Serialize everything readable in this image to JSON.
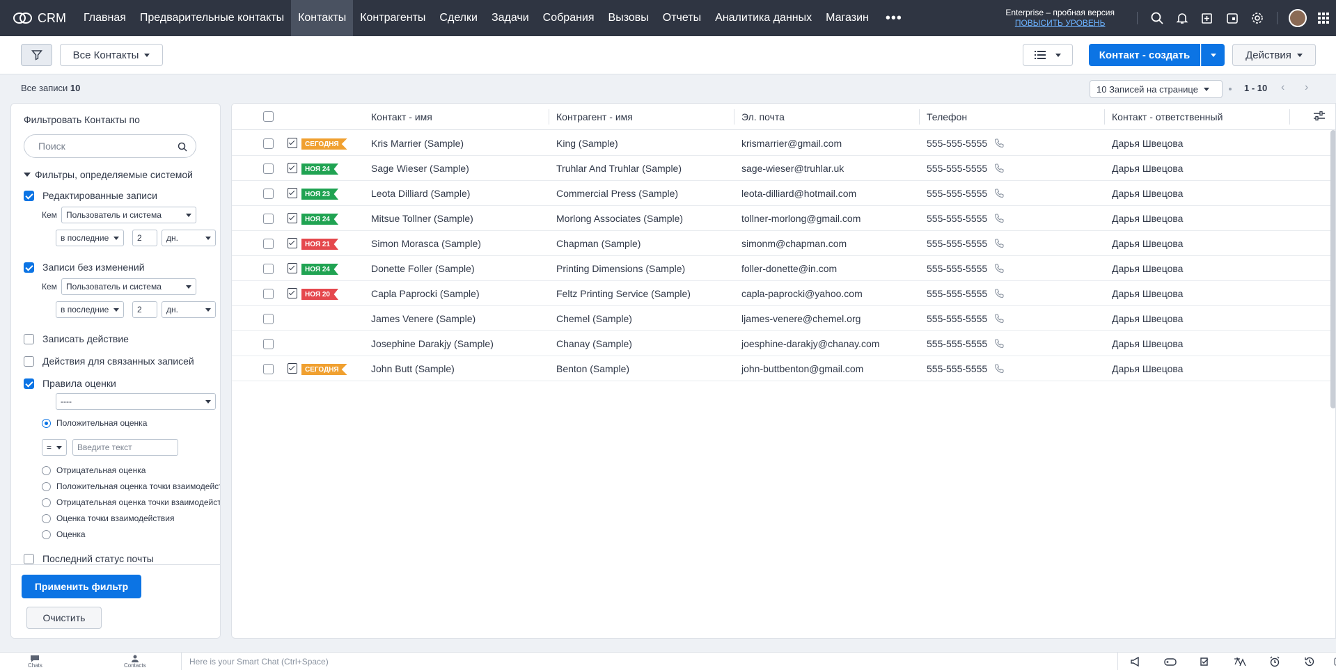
{
  "app": {
    "name": "CRM"
  },
  "nav": {
    "items": [
      "Главная",
      "Предварительные контакты",
      "Контакты",
      "Контрагенты",
      "Сделки",
      "Задачи",
      "Собрания",
      "Вызовы",
      "Отчеты",
      "Аналитика данных",
      "Магазин"
    ],
    "active_index": 2,
    "more": "•••",
    "trial_text": "Enterprise – пробная версия",
    "upgrade_link": "ПОВЫСИТЬ УРОВЕНЬ"
  },
  "toolbar": {
    "view_label": "Все Контакты",
    "create_label": "Контакт - создать",
    "actions_label": "Действия"
  },
  "records": {
    "total_label": "Все записи",
    "total_count": "10",
    "per_page": "10 Записей на странице",
    "range": "1 - 10"
  },
  "filters": {
    "title": "Фильтровать Контакты по",
    "search_placeholder": "Поиск",
    "system_section": "Фильтры, определяемые системой",
    "edited": {
      "label": "Редактированные записи",
      "by_label": "Кем",
      "by_value": "Пользователь и система",
      "period": "в последние",
      "count": "2",
      "unit": "дн."
    },
    "unchanged": {
      "label": "Записи без изменений",
      "by_label": "Кем",
      "by_value": "Пользователь и система",
      "period": "в последние",
      "count": "2",
      "unit": "дн."
    },
    "record_action": "Записать действие",
    "related_actions": "Действия для связанных записей",
    "rating_rules": "Правила оценки",
    "rating_select": "----",
    "positive": "Положительная оценка",
    "operator": "=",
    "text_placeholder": "Введите текст",
    "negative": "Отрицательная оценка",
    "positive_touch": "Положительная оценка точки взаимодействия",
    "negative_touch": "Отрицательная оценка точки взаимодействия",
    "touch_score": "Оценка точки взаимодействия",
    "score": "Оценка",
    "last_mail_status": "Последний статус почты",
    "apply": "Применить фильтр",
    "clear": "Очистить"
  },
  "table": {
    "columns": [
      "Контакт - имя",
      "Контрагент - имя",
      "Эл. почта",
      "Телефон",
      "Контакт - ответственный"
    ],
    "rows": [
      {
        "badge": "СЕГОДНЯ",
        "badge_color": "#f0a030",
        "task": true,
        "name": "Kris Marrier (Sample)",
        "account": "King (Sample)",
        "email": "krismarrier@gmail.com",
        "phone": "555-555-5555",
        "owner": "Дарья Швецова"
      },
      {
        "badge": "НОЯ 24",
        "badge_color": "#20a352",
        "task": true,
        "name": "Sage Wieser (Sample)",
        "account": "Truhlar And Truhlar (Sample)",
        "email": "sage-wieser@truhlar.uk",
        "phone": "555-555-5555",
        "owner": "Дарья Швецова"
      },
      {
        "badge": "НОЯ 23",
        "badge_color": "#20a352",
        "task": true,
        "name": "Leota Dilliard (Sample)",
        "account": "Commercial Press (Sample)",
        "email": "leota-dilliard@hotmail.com",
        "phone": "555-555-5555",
        "owner": "Дарья Швецова"
      },
      {
        "badge": "НОЯ 24",
        "badge_color": "#20a352",
        "task": true,
        "name": "Mitsue Tollner (Sample)",
        "account": "Morlong Associates (Sample)",
        "email": "tollner-morlong@gmail.com",
        "phone": "555-555-5555",
        "owner": "Дарья Швецова"
      },
      {
        "badge": "НОЯ 21",
        "badge_color": "#e5484d",
        "task": true,
        "name": "Simon Morasca (Sample)",
        "account": "Chapman (Sample)",
        "email": "simonm@chapman.com",
        "phone": "555-555-5555",
        "owner": "Дарья Швецова"
      },
      {
        "badge": "НОЯ 24",
        "badge_color": "#20a352",
        "task": true,
        "name": "Donette Foller (Sample)",
        "account": "Printing Dimensions (Sample)",
        "email": "foller-donette@in.com",
        "phone": "555-555-5555",
        "owner": "Дарья Швецова"
      },
      {
        "badge": "НОЯ 20",
        "badge_color": "#e5484d",
        "task": true,
        "name": "Capla Paprocki (Sample)",
        "account": "Feltz Printing Service (Sample)",
        "email": "capla-paprocki@yahoo.com",
        "phone": "555-555-5555",
        "owner": "Дарья Швецова"
      },
      {
        "badge": "",
        "badge_color": "",
        "task": false,
        "name": "James Venere (Sample)",
        "account": "Chemel (Sample)",
        "email": "ljames-venere@chemel.org",
        "phone": "555-555-5555",
        "owner": "Дарья Швецова"
      },
      {
        "badge": "",
        "badge_color": "",
        "task": false,
        "name": "Josephine Darakjy (Sample)",
        "account": "Chanay (Sample)",
        "email": "joesphine-darakjy@chanay.com",
        "phone": "555-555-5555",
        "owner": "Дарья Швецова"
      },
      {
        "badge": "СЕГОДНЯ",
        "badge_color": "#f0a030",
        "task": true,
        "name": "John Butt (Sample)",
        "account": "Benton (Sample)",
        "email": "john-buttbenton@gmail.com",
        "phone": "555-555-5555",
        "owner": "Дарья Швецова"
      }
    ]
  },
  "bottombar": {
    "chats": "Chats",
    "contacts": "Contacts",
    "smart_chat_placeholder": "Here is your Smart Chat (Ctrl+Space)"
  },
  "colors": {
    "nav_bg": "#2f3542",
    "accent": "#0c74e4"
  }
}
